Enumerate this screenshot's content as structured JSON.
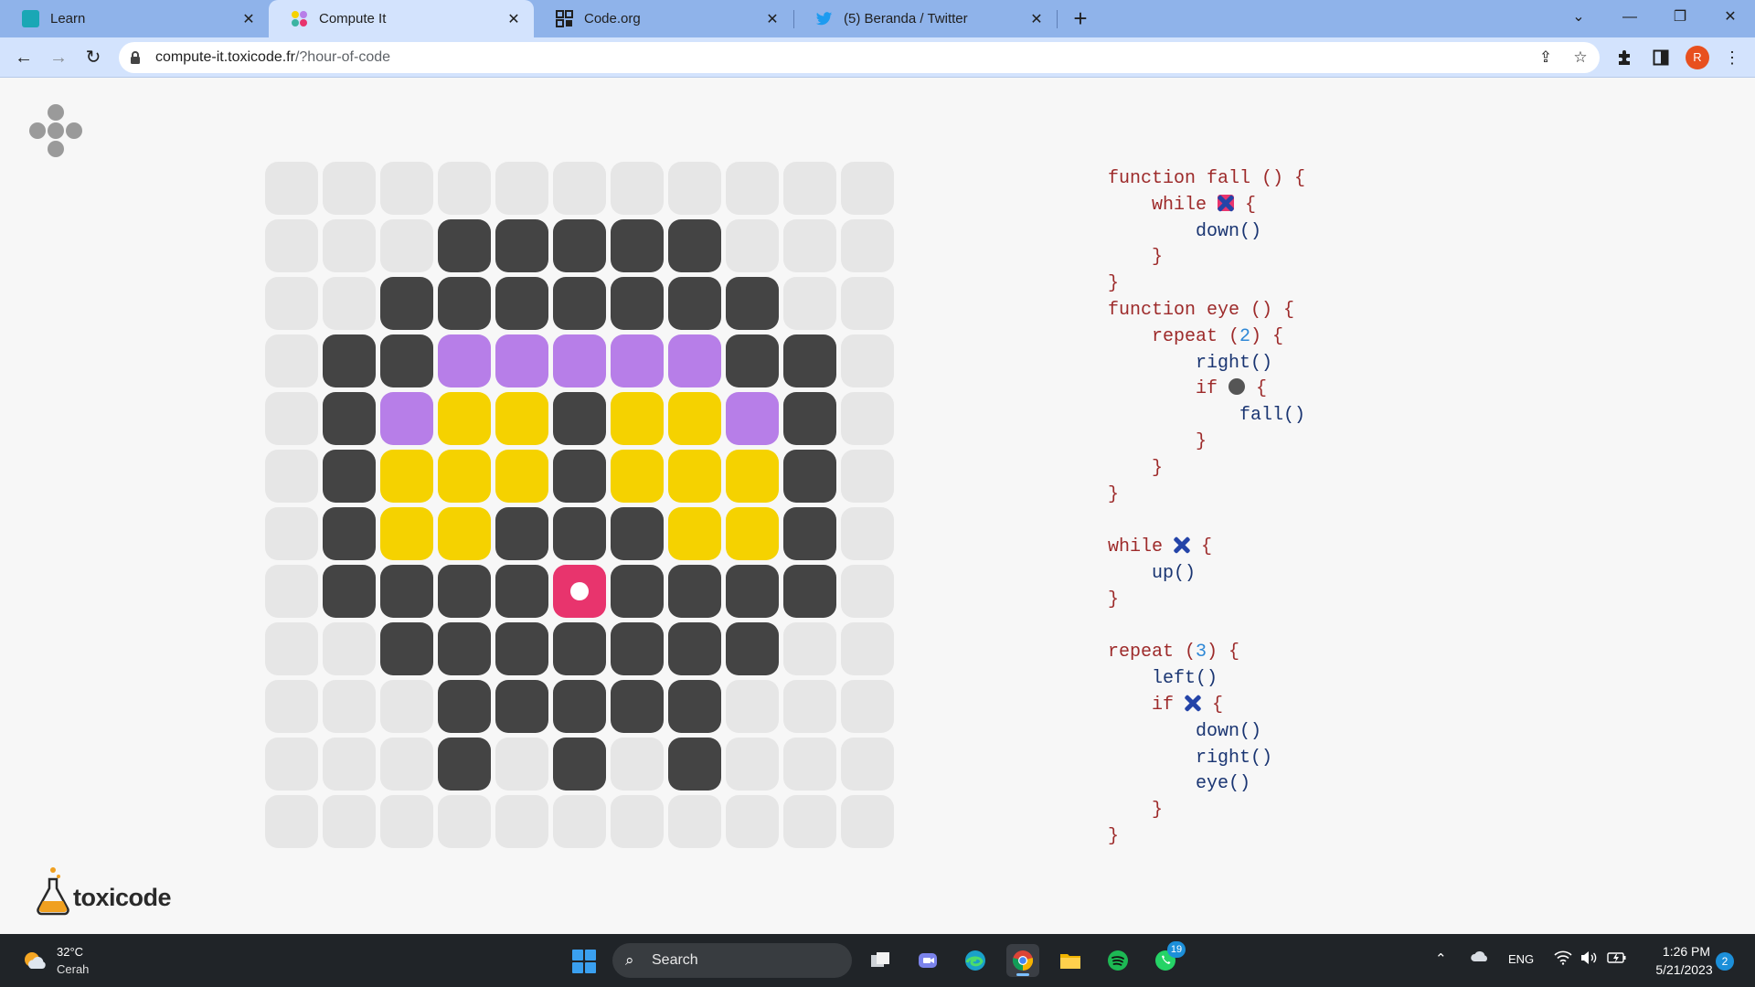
{
  "browser": {
    "tabs": [
      {
        "title": "Learn",
        "favicon": "code-org-learn-icon",
        "active": false
      },
      {
        "title": "Compute It",
        "favicon": "compute-it-icon",
        "active": true
      },
      {
        "title": "Code.org",
        "favicon": "code-org-icon",
        "active": false
      },
      {
        "title": "(5) Beranda / Twitter",
        "favicon": "twitter-icon",
        "active": false
      }
    ],
    "url_host": "compute-it.toxicode.fr",
    "url_path": "/?hour-of-code"
  },
  "profile_initial": "R",
  "puzzle": {
    "colors": {
      "0": "#e6e6e6",
      "1": "#444444",
      "2": "#b77ee8",
      "3": "#f5d200",
      "4": "#e8346d"
    },
    "cursor_position": {
      "row": 7,
      "col": 5
    },
    "rows": [
      [
        0,
        0,
        0,
        0,
        0,
        0,
        0,
        0,
        0,
        0,
        0
      ],
      [
        0,
        0,
        0,
        1,
        1,
        1,
        1,
        1,
        0,
        0,
        0
      ],
      [
        0,
        0,
        1,
        1,
        1,
        1,
        1,
        1,
        1,
        0,
        0
      ],
      [
        0,
        1,
        1,
        2,
        2,
        2,
        2,
        2,
        1,
        1,
        0
      ],
      [
        0,
        1,
        2,
        3,
        3,
        1,
        3,
        3,
        2,
        1,
        0
      ],
      [
        0,
        1,
        3,
        3,
        3,
        1,
        3,
        3,
        3,
        1,
        0
      ],
      [
        0,
        1,
        3,
        3,
        1,
        1,
        1,
        3,
        3,
        1,
        0
      ],
      [
        0,
        1,
        1,
        1,
        1,
        4,
        1,
        1,
        1,
        1,
        0
      ],
      [
        0,
        0,
        1,
        1,
        1,
        1,
        1,
        1,
        1,
        0,
        0
      ],
      [
        0,
        0,
        0,
        1,
        1,
        1,
        1,
        1,
        0,
        0,
        0
      ],
      [
        0,
        0,
        0,
        1,
        0,
        1,
        0,
        1,
        0,
        0,
        0
      ],
      [
        0,
        0,
        0,
        0,
        0,
        0,
        0,
        0,
        0,
        0,
        0
      ]
    ]
  },
  "code": {
    "lines": [
      [
        {
          "t": "function fall () {",
          "c": "kw"
        }
      ],
      [
        {
          "t": "    while ",
          "c": "kw"
        },
        {
          "icon": "cross-red"
        },
        {
          "t": " {",
          "c": "kw"
        }
      ],
      [
        {
          "t": "        down()",
          "c": "fn"
        }
      ],
      [
        {
          "t": "    }",
          "c": "kw"
        }
      ],
      [
        {
          "t": "}",
          "c": "kw"
        }
      ],
      [
        {
          "t": "function eye () {",
          "c": "kw"
        }
      ],
      [
        {
          "t": "    repeat (",
          "c": "kw"
        },
        {
          "t": "2",
          "c": "num"
        },
        {
          "t": ") {",
          "c": "kw"
        }
      ],
      [
        {
          "t": "        right()",
          "c": "fn"
        }
      ],
      [
        {
          "t": "        if ",
          "c": "kw"
        },
        {
          "icon": "dot"
        },
        {
          "t": " {",
          "c": "kw"
        }
      ],
      [
        {
          "t": "            fall()",
          "c": "fn"
        }
      ],
      [
        {
          "t": "        }",
          "c": "kw"
        }
      ],
      [
        {
          "t": "    }",
          "c": "kw"
        }
      ],
      [
        {
          "t": "}",
          "c": "kw"
        }
      ],
      [
        {
          "t": "",
          "c": "kw"
        }
      ],
      [
        {
          "t": "while ",
          "c": "kw"
        },
        {
          "icon": "cross"
        },
        {
          "t": " {",
          "c": "kw"
        }
      ],
      [
        {
          "t": "    up()",
          "c": "fn"
        }
      ],
      [
        {
          "t": "}",
          "c": "kw"
        }
      ],
      [
        {
          "t": "",
          "c": "kw"
        }
      ],
      [
        {
          "t": "repeat (",
          "c": "kw"
        },
        {
          "t": "3",
          "c": "num"
        },
        {
          "t": ") {",
          "c": "kw"
        }
      ],
      [
        {
          "t": "    left()",
          "c": "fn"
        }
      ],
      [
        {
          "t": "    if ",
          "c": "kw"
        },
        {
          "icon": "cross"
        },
        {
          "t": " {",
          "c": "kw"
        }
      ],
      [
        {
          "t": "        down()",
          "c": "fn"
        }
      ],
      [
        {
          "t": "        right()",
          "c": "fn"
        }
      ],
      [
        {
          "t": "        eye()",
          "c": "fn"
        }
      ],
      [
        {
          "t": "    }",
          "c": "kw"
        }
      ],
      [
        {
          "t": "}",
          "c": "kw"
        }
      ]
    ]
  },
  "brand": {
    "name": "toxicode"
  },
  "taskbar": {
    "weather_temp": "32°C",
    "weather_condition": "Cerah",
    "search_label": "Search",
    "whatsapp_badge": "19",
    "language": "ENG",
    "time": "1:26 PM",
    "date": "5/21/2023",
    "notification_count": "2"
  }
}
